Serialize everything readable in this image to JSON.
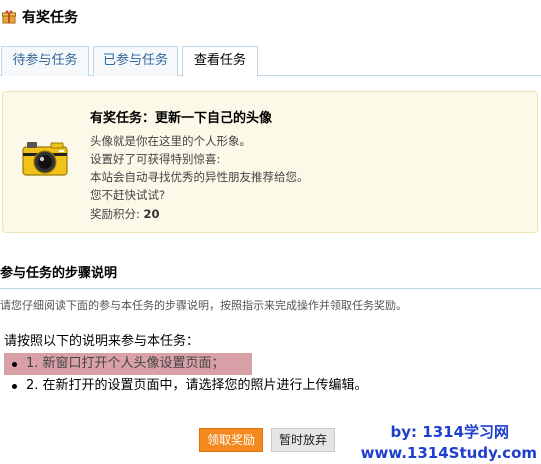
{
  "header": {
    "title": "有奖任务"
  },
  "tabs": [
    {
      "label": "待参与任务",
      "active": false
    },
    {
      "label": "已参与任务",
      "active": false
    },
    {
      "label": "查看任务",
      "active": true
    }
  ],
  "task": {
    "title": "有奖任务：更新一下自己的头像",
    "description": [
      "头像就是你在这里的个人形象。",
      "设置好了可获得特别惊喜:",
      "本站会自动寻找优秀的异性朋友推荐给您。",
      "您不赶快试试?"
    ],
    "reward_label": "奖励积分:",
    "reward_value": "20",
    "icon": "camera-icon"
  },
  "steps_section": {
    "title": "参与任务的步骤说明",
    "description": "请您仔细阅读下面的参与本任务的步骤说明，按照指示来完成操作并领取任务奖励。",
    "intro": "请按照以下的说明来参与本任务：",
    "steps": [
      "1. 新窗口打开个人头像设置页面；",
      "2. 在新打开的设置页面中，请选择您的照片进行上传编辑。"
    ]
  },
  "buttons": {
    "claim": "领取奖励",
    "abandon": "暂时放弃"
  },
  "watermark": {
    "line1": "by: 1314学习网",
    "line2": "www.1314Study.com"
  },
  "colors": {
    "accent": "#f48a1f",
    "tab_text": "#336699",
    "highlight": "#d9a0a8",
    "box_bg": "#fdf9e8",
    "watermark": "#1e3fd0"
  }
}
